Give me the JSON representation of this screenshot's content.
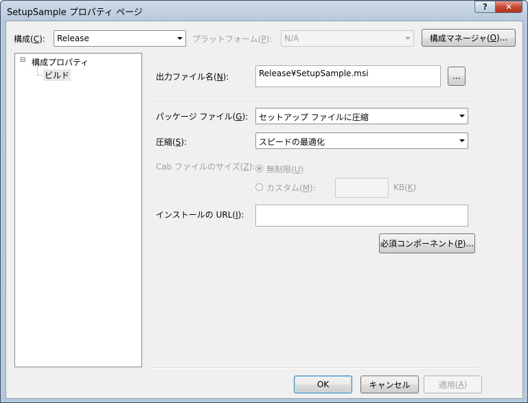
{
  "window": {
    "title": "SetupSample プロパティ ページ",
    "help_glyph": "?",
    "close_glyph": "✕"
  },
  "toolbar": {
    "config_label": "構成(",
    "config_key": "C",
    "config_label_end": "):",
    "config_value": "Release",
    "platform_label": "プラットフォーム(",
    "platform_key": "P",
    "platform_label_end": "):",
    "platform_value": "N/A",
    "manager_button": "構成マネージャ(",
    "manager_key": "O",
    "manager_button_end": ")..."
  },
  "tree": {
    "root_toggle": "⊟",
    "root_label": "構成プロパティ",
    "child_label": "ビルド"
  },
  "form": {
    "output_label": "出力ファイル名(",
    "output_key": "N",
    "output_label_end": "):",
    "output_value": "Release¥SetupSample.msi",
    "browse_button": "...",
    "package_label": "パッケージ ファイル(",
    "package_key": "G",
    "package_label_end": "):",
    "package_value": "セットアップ ファイルに圧縮",
    "compression_label": "圧縮(",
    "compression_key": "S",
    "compression_label_end": "):",
    "compression_value": "スピードの最適化",
    "cab_label": "Cab ファイルのサイズ(",
    "cab_key": "Z",
    "cab_label_end": "):",
    "unlimited_label": "無制限(",
    "unlimited_key": "U",
    "unlimited_label_end": ")",
    "custom_label": "カスタム(",
    "custom_key": "M",
    "custom_label_end": "):",
    "custom_value": "",
    "kb_label": "KB(",
    "kb_key": "K",
    "kb_label_end": ")",
    "url_label": "インストールの URL(",
    "url_key": "I",
    "url_label_end": "):",
    "url_value": "",
    "prereq_button": "必須コンポーネント(",
    "prereq_key": "P",
    "prereq_button_end": ")..."
  },
  "footer": {
    "ok": "OK",
    "cancel": "キャンセル",
    "apply": "適用(",
    "apply_key": "A",
    "apply_end": ")"
  }
}
